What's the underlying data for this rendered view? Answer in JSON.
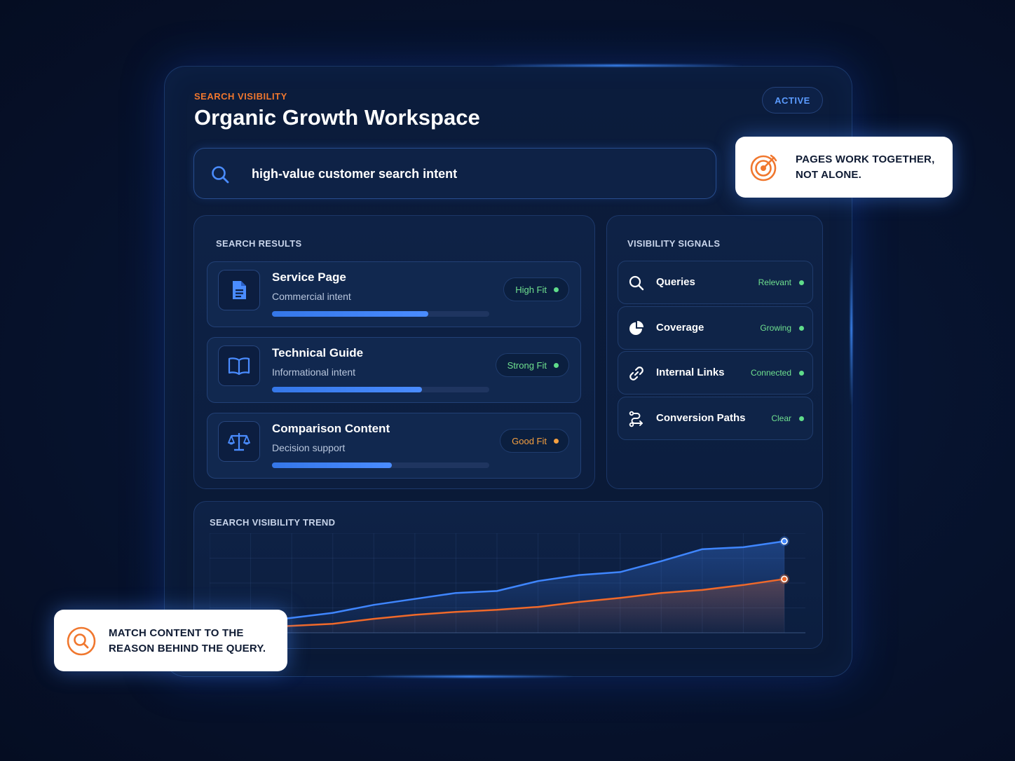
{
  "header": {
    "eyebrow": "SEARCH VISIBILITY",
    "title": "Organic Growth Workspace",
    "status": "ACTIVE"
  },
  "search": {
    "query": "high-value customer search intent",
    "icon": "search-icon"
  },
  "callouts": {
    "top": {
      "icon": "target-icon",
      "text": "PAGES WORK TOGETHER, NOT ALONE."
    },
    "bottom": {
      "icon": "search-icon",
      "text": "MATCH CONTENT TO THE REASON BEHIND THE QUERY."
    }
  },
  "results": {
    "label": "SEARCH RESULTS",
    "items": [
      {
        "title": "Service Page",
        "subtitle": "Commercial intent",
        "badge": "High Fit",
        "badge_color": "#6fe08f",
        "dot_color": "#5fdc8a",
        "progress": 0.72,
        "icon": "document-icon"
      },
      {
        "title": "Technical Guide",
        "subtitle": "Informational intent",
        "badge": "Strong Fit",
        "badge_color": "#6fe08f",
        "dot_color": "#5fdc8a",
        "progress": 0.69,
        "icon": "book-icon"
      },
      {
        "title": "Comparison Content",
        "subtitle": "Decision support",
        "badge": "Good Fit",
        "badge_color": "#f5a040",
        "dot_color": "#f5a040",
        "progress": 0.55,
        "icon": "scale-icon"
      }
    ]
  },
  "signals": {
    "label": "VISIBILITY SIGNALS",
    "items": [
      {
        "label": "Queries",
        "status": "Relevant",
        "icon": "search-icon"
      },
      {
        "label": "Coverage",
        "status": "Growing",
        "icon": "pie-chart-icon"
      },
      {
        "label": "Internal Links",
        "status": "Connected",
        "icon": "link-icon"
      },
      {
        "label": "Conversion Paths",
        "status": "Clear",
        "icon": "route-icon"
      }
    ]
  },
  "trend": {
    "label": "SEARCH VISIBILITY TREND"
  },
  "chart_data": {
    "type": "area",
    "title": "SEARCH VISIBILITY TREND",
    "x": [
      0,
      1,
      2,
      3,
      4,
      5,
      6,
      7,
      8,
      9,
      10,
      11,
      12,
      13,
      14
    ],
    "series": [
      {
        "color": "#3f86ff",
        "values": [
          5,
          10,
          15,
          20,
          28,
          34,
          40,
          42,
          52,
          58,
          61,
          72,
          84,
          86,
          92
        ]
      },
      {
        "color": "#f0692a",
        "values": [
          3,
          5,
          7,
          9,
          14,
          18,
          21,
          23,
          26,
          31,
          35,
          40,
          43,
          48,
          54
        ]
      }
    ],
    "ylim": [
      0,
      100
    ],
    "grid": true,
    "legend": false
  }
}
